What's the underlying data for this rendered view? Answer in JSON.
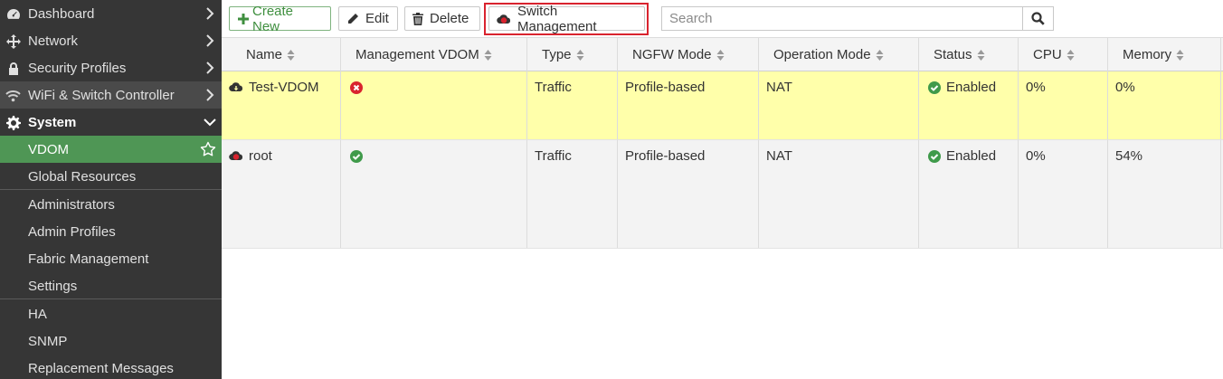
{
  "sidebar": {
    "items": [
      {
        "label": "Dashboard",
        "icon": "dashboard-icon"
      },
      {
        "label": "Network",
        "icon": "network-arrows-icon"
      },
      {
        "label": "Security Profiles",
        "icon": "lock-icon"
      },
      {
        "label": "WiFi & Switch Controller",
        "icon": "wifi-icon"
      },
      {
        "label": "System",
        "icon": "gear-icon"
      },
      {
        "label": "VDOM"
      },
      {
        "label": "Global Resources"
      },
      {
        "label": "Administrators"
      },
      {
        "label": "Admin Profiles"
      },
      {
        "label": "Fabric Management"
      },
      {
        "label": "Settings"
      },
      {
        "label": "HA"
      },
      {
        "label": "SNMP"
      },
      {
        "label": "Replacement Messages"
      }
    ]
  },
  "toolbar": {
    "create_label": "Create New",
    "edit_label": "Edit",
    "delete_label": "Delete",
    "switch_label": "Switch Management",
    "search_placeholder": "Search"
  },
  "table": {
    "columns": [
      "Name",
      "Management VDOM",
      "Type",
      "NGFW Mode",
      "Operation Mode",
      "Status",
      "CPU",
      "Memory"
    ],
    "rows": [
      {
        "name": "Test-VDOM",
        "mgmt": "no",
        "type": "Traffic",
        "ngfw": "Profile-based",
        "opmode": "NAT",
        "status": "Enabled",
        "cpu": "0%",
        "memory": "0%"
      },
      {
        "name": "root",
        "mgmt": "yes",
        "type": "Traffic",
        "ngfw": "Profile-based",
        "opmode": "NAT",
        "status": "Enabled",
        "cpu": "0%",
        "memory": "54%"
      }
    ]
  },
  "colors": {
    "sidebar_bg": "#363636",
    "active_green": "#4f9655",
    "selected_row": "#ffffaa",
    "error_red": "#d9232e",
    "success_green": "#3f9a4a"
  }
}
